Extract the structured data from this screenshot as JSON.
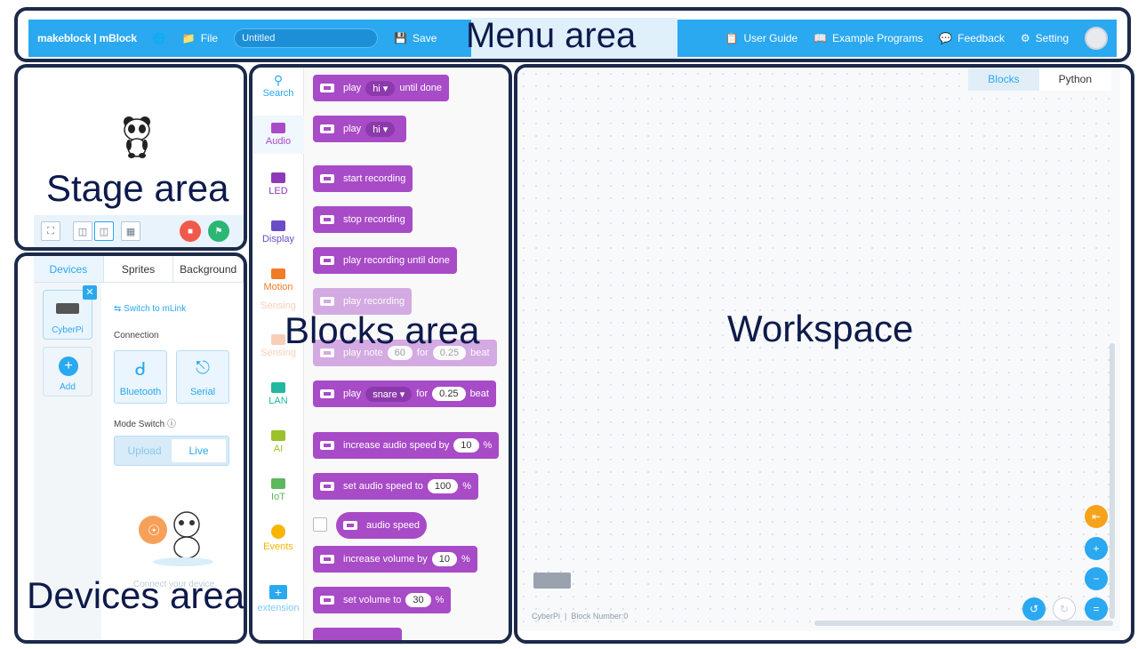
{
  "menu": {
    "brand": "makeblock | mBlock",
    "file": "File",
    "project_title": "Untitled",
    "save": "Save",
    "region_label": "Menu area",
    "user_guide": "User Guide",
    "example_programs": "Example Programs",
    "feedback": "Feedback",
    "setting": "Setting"
  },
  "stage": {
    "region_label": "Stage area"
  },
  "devices": {
    "tabs": [
      "Devices",
      "Sprites",
      "Background"
    ],
    "device_name": "CyberPi",
    "add": "Add",
    "switch_link": "Switch to mLink",
    "connection": "Connection",
    "bluetooth": "Bluetooth",
    "serial": "Serial",
    "mode_switch": "Mode Switch",
    "upload": "Upload",
    "live": "Live",
    "connect_hint": "Connect your device",
    "region_label": "Devices area"
  },
  "categories": [
    {
      "label": "Search",
      "color": "#2aa8f0"
    },
    {
      "label": "Audio",
      "color": "#a84bc7"
    },
    {
      "label": "LED",
      "color": "#8e3ab8"
    },
    {
      "label": "Display",
      "color": "#6a4cc7"
    },
    {
      "label": "Motion",
      "color": "#f07c28"
    },
    {
      "label": "Sensing",
      "color": "#f0a070"
    },
    {
      "label": "Sensing",
      "color": "#f0a070"
    },
    {
      "label": "LAN",
      "color": "#22b8a0"
    },
    {
      "label": "AI",
      "color": "#9ac22a"
    },
    {
      "label": "IoT",
      "color": "#5cb85c"
    },
    {
      "label": "Events",
      "color": "#f7b500"
    },
    {
      "label": "extension",
      "color": "#2aa8f0"
    }
  ],
  "blocks": {
    "region_label": "Blocks area",
    "b1": {
      "play": "play",
      "sound": "hi",
      "suffix": "until done"
    },
    "b2": {
      "play": "play",
      "sound": "hi"
    },
    "b3": "start recording",
    "b4": "stop recording",
    "b5": "play recording until done",
    "b6": "play recording",
    "b7": {
      "play": "play note",
      "note": "60",
      "for": "for",
      "beats": "0.25",
      "unit": "beat"
    },
    "b8": {
      "play": "play",
      "sound": "snare",
      "for": "for",
      "beats": "0.25",
      "unit": "beat"
    },
    "b9": {
      "text": "increase audio speed by",
      "value": "10",
      "unit": "%"
    },
    "b10": {
      "text": "set audio speed to",
      "value": "100",
      "unit": "%"
    },
    "b11": "audio speed",
    "b12": {
      "text": "increase volume by",
      "value": "10",
      "unit": "%"
    },
    "b13": {
      "text": "set volume to",
      "value": "30",
      "unit": "%"
    }
  },
  "workspace": {
    "tab_blocks": "Blocks",
    "tab_python": "Python",
    "region_label": "Workspace",
    "device": "CyberPi",
    "block_number": "Block Number:0"
  },
  "colors": {
    "accent": "#2aa8f0",
    "block": "#a84bc7",
    "frame": "#1c2a4a",
    "stop": "#f05a4a",
    "go": "#2bb673",
    "orange": "#f7a21c"
  }
}
